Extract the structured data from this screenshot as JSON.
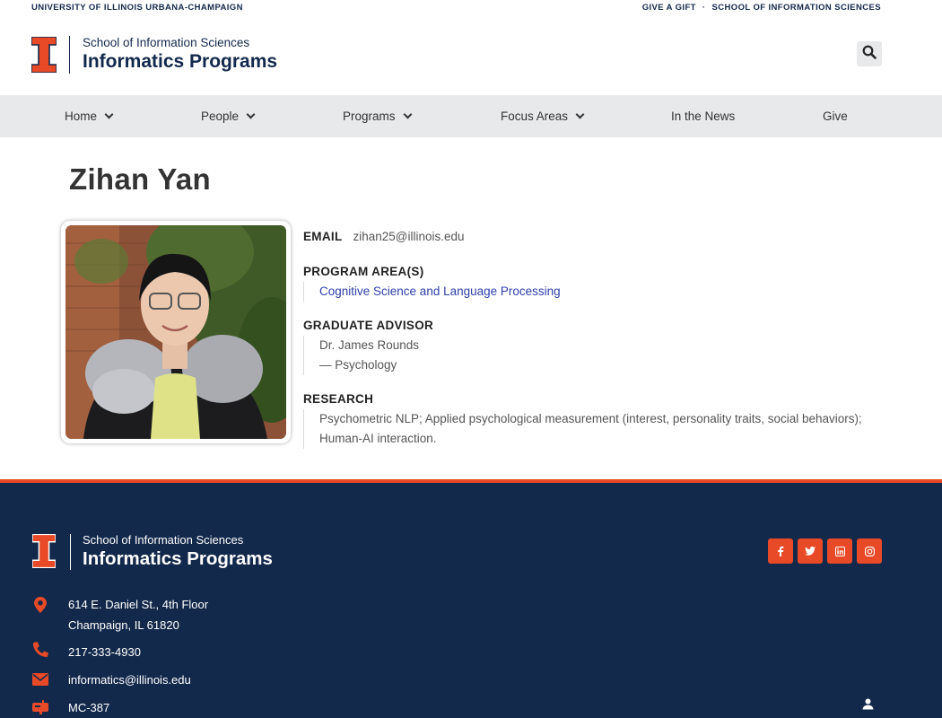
{
  "utility": {
    "university": "UNIVERSITY OF ILLINOIS URBANA-CHAMPAIGN",
    "give_link": "GIVE A GIFT",
    "separator": "·",
    "school_link": "SCHOOL OF INFORMATION SCIENCES"
  },
  "header": {
    "logo_small": "School of Information Sciences",
    "logo_big": "Informatics Programs",
    "search_icon": "search-icon"
  },
  "nav": {
    "items": [
      {
        "label": "Home",
        "has_dropdown": true
      },
      {
        "label": "People",
        "has_dropdown": true
      },
      {
        "label": "Programs",
        "has_dropdown": true
      },
      {
        "label": "Focus Areas",
        "has_dropdown": true
      },
      {
        "label": "In the News",
        "has_dropdown": false
      },
      {
        "label": "Give",
        "has_dropdown": false
      }
    ]
  },
  "profile": {
    "name": "Zihan Yan",
    "email_label": "EMAIL",
    "email": "zihan25@illinois.edu",
    "program_label": "PROGRAM AREA(S)",
    "program": "Cognitive Science and Language Processing",
    "advisor_label": "GRADUATE ADVISOR",
    "advisor_name": "Dr. James Rounds",
    "advisor_dept": "— Psychology",
    "research_label": "RESEARCH",
    "research": "Psychometric NLP; Applied psychological measurement (interest, personality traits, social behaviors); Human-AI interaction."
  },
  "footer": {
    "logo_small": "School of Information Sciences",
    "logo_big": "Informatics Programs",
    "address_line1": "614 E. Daniel St., 4th Floor",
    "address_line2": "Champaign, IL 61820",
    "phone": "217-333-4930",
    "email": "informatics@illinois.edu",
    "mail_code": "MC-387",
    "socials": [
      "facebook-icon",
      "twitter-icon",
      "linkedin-icon",
      "instagram-icon"
    ]
  },
  "colors": {
    "navy": "#13294b",
    "orange": "#e84a27",
    "nav_bg": "#e8e9eb",
    "link": "#2f3fa8"
  }
}
